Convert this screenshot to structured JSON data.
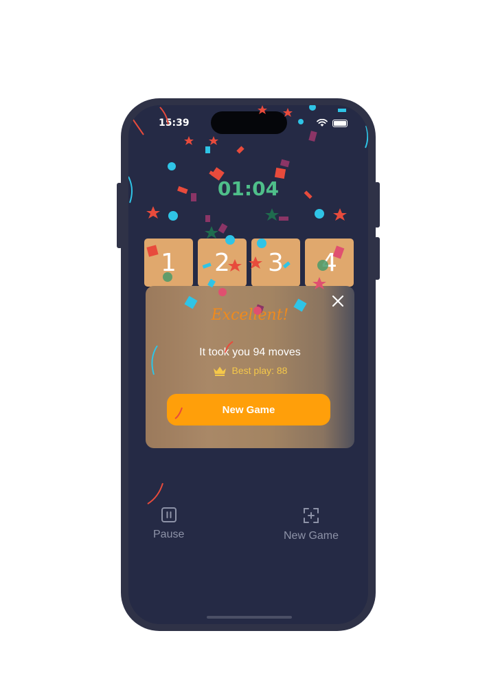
{
  "status": {
    "time": "15:39"
  },
  "timer": "01:04",
  "tiles": [
    "1",
    "2",
    "3",
    "4"
  ],
  "modal": {
    "title": "Excellent!",
    "message": "It took you 94 moves",
    "best_label": "Best play: 88",
    "button_label": "New Game"
  },
  "bottom": {
    "pause_label": "Pause",
    "new_game_label": "New Game"
  },
  "colors": {
    "background": "#252a45",
    "tile": "#e0a86d",
    "timer": "#4fbf8a",
    "accent": "#ff9f0a",
    "title": "#f08a1c",
    "best": "#f5c84a"
  },
  "icons": [
    "wifi-icon",
    "battery-icon",
    "close-icon",
    "crown-icon",
    "pause-icon",
    "new-game-icon"
  ]
}
